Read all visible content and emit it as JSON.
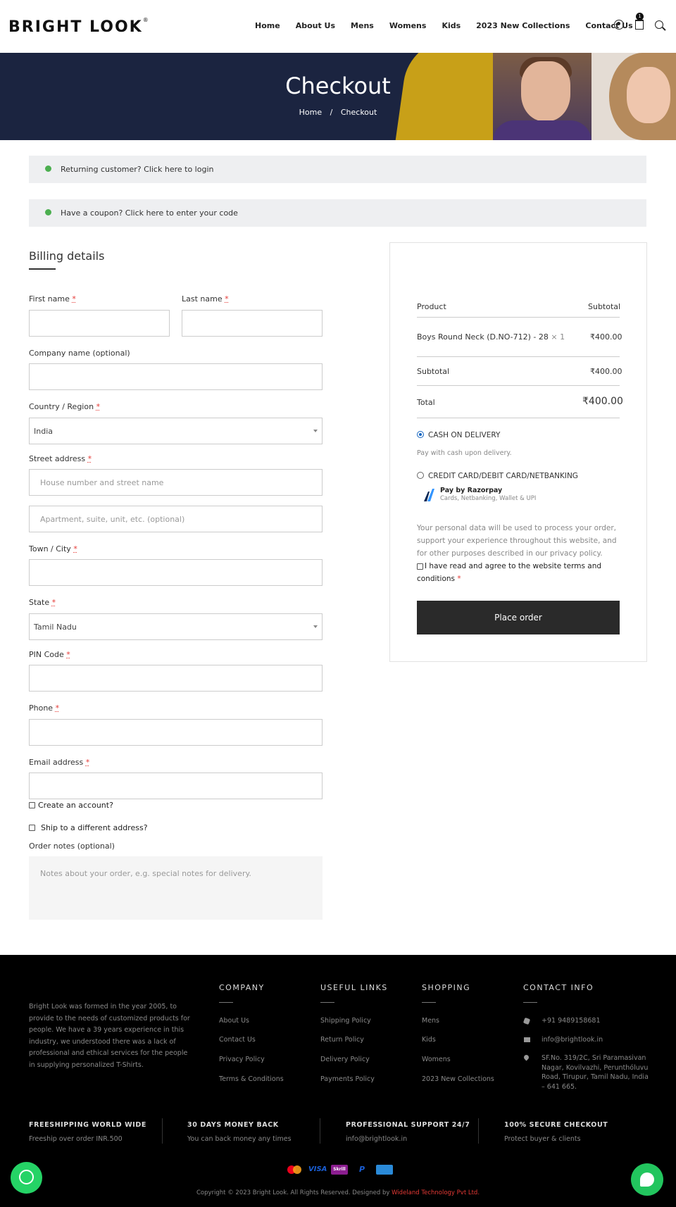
{
  "header": {
    "logo": "BRIGHT LOOK",
    "logo_mark": "®",
    "nav": [
      "Home",
      "About Us",
      "Mens",
      "Womens",
      "Kids",
      "2023 New Collections",
      "Contact Us"
    ],
    "cart_count": "1"
  },
  "banner": {
    "title": "Checkout",
    "breadcrumb": [
      "Home",
      "/",
      "Checkout"
    ]
  },
  "notices": {
    "login": "Returning customer? Click here to login",
    "coupon": "Have a coupon? Click here to enter your code"
  },
  "billing": {
    "title": "Billing details",
    "required_mark": "*",
    "first_name_label": "First name",
    "last_name_label": "Last name",
    "company_label": "Company name (optional)",
    "country_label": "Country / Region",
    "country_value": "India",
    "street_label": "Street address",
    "street_placeholder": "House number and street name",
    "street2_placeholder": "Apartment, suite, unit, etc. (optional)",
    "city_label": "Town / City",
    "state_label": "State",
    "state_value": "Tamil Nadu",
    "pin_label": "PIN Code",
    "phone_label": "Phone",
    "email_label": "Email address",
    "create_account": "Create an account?",
    "ship_different": "Ship to a different address?",
    "notes_label": "Order notes (optional)",
    "notes_placeholder": "Notes about your order, e.g. special notes for delivery."
  },
  "order": {
    "col_product": "Product",
    "col_subtotal": "Subtotal",
    "item_name": "Boys Round Neck (D.NO-712) - 28",
    "item_qty": "× 1",
    "item_price": "₹400.00",
    "subtotal_label": "Subtotal",
    "subtotal_value": "₹400.00",
    "total_label": "Total",
    "total_value": "₹400.00",
    "cod_label": "CASH ON DELIVERY",
    "cod_desc": "Pay with cash upon delivery.",
    "card_label": "CREDIT CARD/DEBIT CARD/NETBANKING",
    "razorpay_title": "Pay by Razorpay",
    "razorpay_sub": "Cards, Netbanking, Wallet & UPI",
    "privacy_1": "Your personal data will be used to process your order,",
    "privacy_2": "support your experience throughout this website, and",
    "privacy_3": "for other purposes described in our privacy policy.",
    "terms_1": "I have read and agree to the website terms and",
    "terms_2": "conditions",
    "place_order": "Place order"
  },
  "footer": {
    "about": "Bright Look was formed in the year 2005, to provide to the needs of customized products for people. We have a 39 years experience in this industry, we understood there was a lack of professional and ethical services for the people in supplying personalized T-Shirts.",
    "company_head": "COMPANY",
    "company_links": [
      "About Us",
      "Contact Us",
      "Privacy Policy",
      "Terms & Conditions"
    ],
    "useful_head": "USEFUL LINKS",
    "useful_links": [
      "Shipping Policy",
      "Return Policy",
      "Delivery Policy",
      "Payments Policy"
    ],
    "shopping_head": "SHOPPING",
    "shopping_links": [
      "Mens",
      "Kids",
      "Womens",
      "2023 New Collections"
    ],
    "contact_head": "CONTACT INFO",
    "phone": "+91 9489158681",
    "email": "info@brightlook.in",
    "address_1": "SF.No. 319/2C, Sri Paramasivan",
    "address_2": "Nagar, Kovilvazhi, Perunthóluvu",
    "address_3": "Road, Tirupur, Tamil Nadu, India",
    "address_4": "– 641 665.",
    "features": [
      {
        "title": "FREESHIPPING WORLD WIDE",
        "sub": "Freeship over order INR.500"
      },
      {
        "title": "30 DAYS MONEY BACK",
        "sub": "You can back money any times"
      },
      {
        "title": "PROFESSIONAL SUPPORT 24/7",
        "sub": "info@brightlook.in"
      },
      {
        "title": "100% SECURE CHECKOUT",
        "sub": "Protect buyer & clients"
      }
    ],
    "payment_icons": [
      "mastercard-icon",
      "visa-icon",
      "skrill-icon",
      "paypal-icon",
      "amex-icon"
    ],
    "payment_visa": "VISA",
    "payment_skrill": "Skrill",
    "payment_paypal": "P",
    "copyright": "Copyright © 2023 Bright Look. All Rights Reserved. Designed by",
    "designer": "Wideland Technology Pvt Ltd."
  },
  "colors": {
    "banner_bg": "#1b2440",
    "accent_green": "#25d366",
    "place_order_bg": "#2a2a2a",
    "required": "#e53935"
  }
}
